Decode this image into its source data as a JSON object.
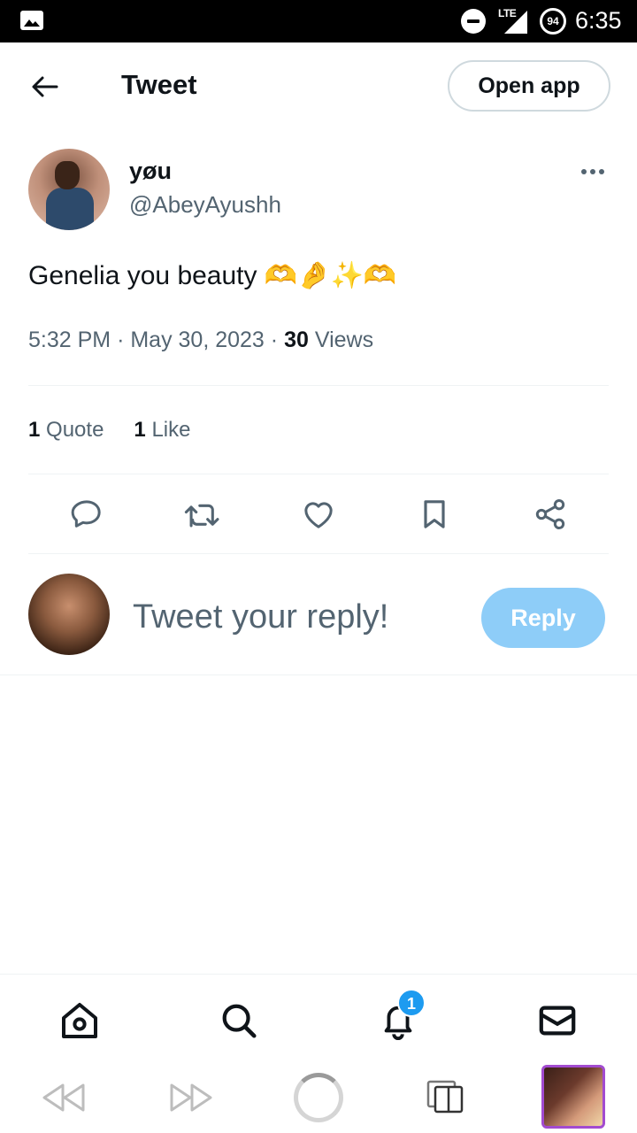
{
  "status_bar": {
    "network": "LTE",
    "battery": "94",
    "time": "6:35"
  },
  "header": {
    "title": "Tweet",
    "open_app_label": "Open app"
  },
  "tweet": {
    "author_name": "yøu",
    "author_handle": "@AbeyAyushh",
    "text": "Genelia you beauty 🫶🤌✨🫶",
    "time": "5:32 PM",
    "date": "May 30, 2023",
    "views_count": "30",
    "views_label": "Views",
    "quote_count": "1",
    "quote_label": "Quote",
    "like_count": "1",
    "like_label": "Like"
  },
  "reply": {
    "placeholder": "Tweet your reply!",
    "button_label": "Reply"
  },
  "bottom_nav": {
    "notifications_badge": "1"
  },
  "colors": {
    "accent": "#1d9bf0",
    "reply_button_disabled": "#8ecdf8",
    "secondary_text": "#536471"
  },
  "icons": {
    "header": [
      "back-arrow-icon"
    ],
    "tweet_actions": [
      "reply-icon",
      "retweet-icon",
      "like-icon",
      "bookmark-icon",
      "share-icon"
    ],
    "bottom_nav": [
      "home-icon",
      "search-icon",
      "notifications-icon",
      "messages-icon"
    ],
    "browser_bar": [
      "rewind-icon",
      "fast-forward-icon",
      "loading-icon",
      "tabs-icon"
    ]
  }
}
